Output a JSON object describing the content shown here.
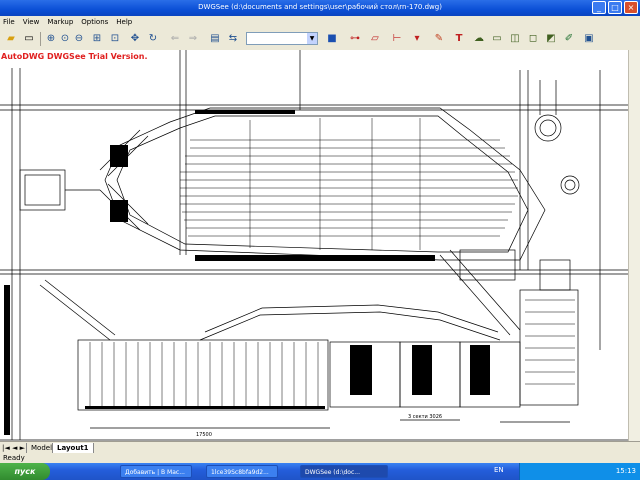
{
  "window": {
    "title": "DWGSee (d:\\documents and settings\\user\\рабочий стол\\rn-170.dwg)"
  },
  "menu": [
    "File",
    "View",
    "Markup",
    "Options",
    "Help"
  ],
  "toolbar": {
    "combo_value": ""
  },
  "trial_text": "AutoDWG DWGSee Trial Version.",
  "drawing": {
    "dim_left": "17500",
    "dim_right": "3 секти 3026"
  },
  "tabs": {
    "nav": "|◄ ◄ ► ►|",
    "items": [
      "Model",
      "Layout1"
    ],
    "active": "Layout1"
  },
  "status": "Ready",
  "taskbar": {
    "start": "пуск",
    "buttons": [
      "Добавить | В Мас...",
      "1lce39Sc8bfa9d2...",
      "DWGSee (d:\\doc..."
    ],
    "lang": "EN",
    "clock": "15:13"
  },
  "colors": {
    "titlebar": "#0b4fd6",
    "trial_text": "#e02020",
    "drawing_lines": "#000000",
    "taskbar": "#245edb"
  }
}
